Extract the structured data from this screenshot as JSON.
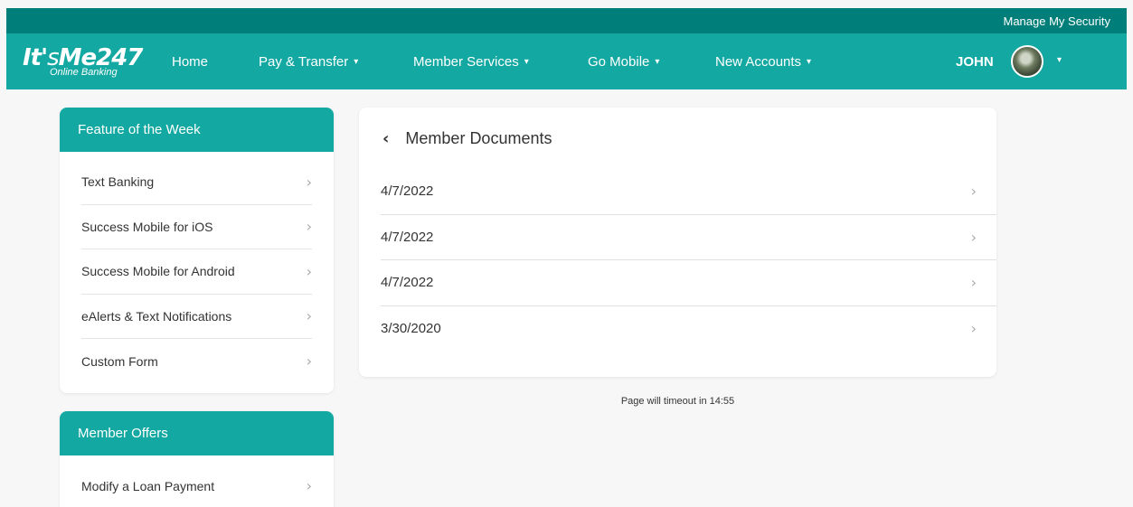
{
  "top": {
    "manage_security": "Manage My Security"
  },
  "logo": {
    "brand": "It's Me 247",
    "sub": "Online Banking"
  },
  "nav": {
    "home": "Home",
    "pay_transfer": "Pay & Transfer",
    "member_services": "Member Services",
    "go_mobile": "Go Mobile",
    "new_accounts": "New Accounts",
    "user": "JOHN"
  },
  "feature": {
    "title": "Feature of the Week",
    "items": [
      "Text Banking",
      "Success Mobile for iOS",
      "Success Mobile for Android",
      "eAlerts & Text Notifications",
      "Custom Form"
    ]
  },
  "offers": {
    "title": "Member Offers",
    "items": [
      "Modify a Loan Payment"
    ]
  },
  "documents": {
    "title": "Member Documents",
    "items": [
      "4/7/2022",
      "4/7/2022",
      "4/7/2022",
      "3/30/2020"
    ]
  },
  "timeout_text": "Page will timeout in 14:55",
  "colors": {
    "teal": "#14a8a2",
    "dark_teal": "#007f7a",
    "background": "#f7f7f7"
  },
  "icons": {
    "chevron": "chevron-right-icon",
    "back": "chevron-left-icon",
    "caret": "caret-down-icon"
  }
}
